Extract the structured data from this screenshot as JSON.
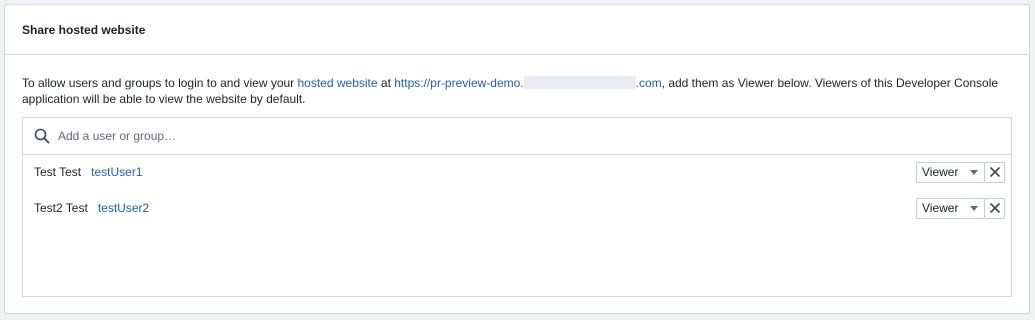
{
  "panel": {
    "title": "Share hosted website"
  },
  "description": {
    "text_before": "To allow users and groups to login to and view your ",
    "link_text": "hosted website",
    "text_at": " at ",
    "url_prefix": "https://pr-preview-demo.",
    "url_suffix": ".com",
    "text_after": ", add them as Viewer below. Viewers of this Developer Console application will be able to view the website by default."
  },
  "search": {
    "placeholder": "Add a user or group…",
    "icon": "search-icon"
  },
  "users": [
    {
      "name": "Test Test",
      "id": "testUser1",
      "role": "Viewer"
    },
    {
      "name": "Test2 Test",
      "id": "testUser2",
      "role": "Viewer"
    }
  ],
  "colors": {
    "link": "#215db0",
    "border": "#d3d8de",
    "background": "#f1f2f4"
  }
}
